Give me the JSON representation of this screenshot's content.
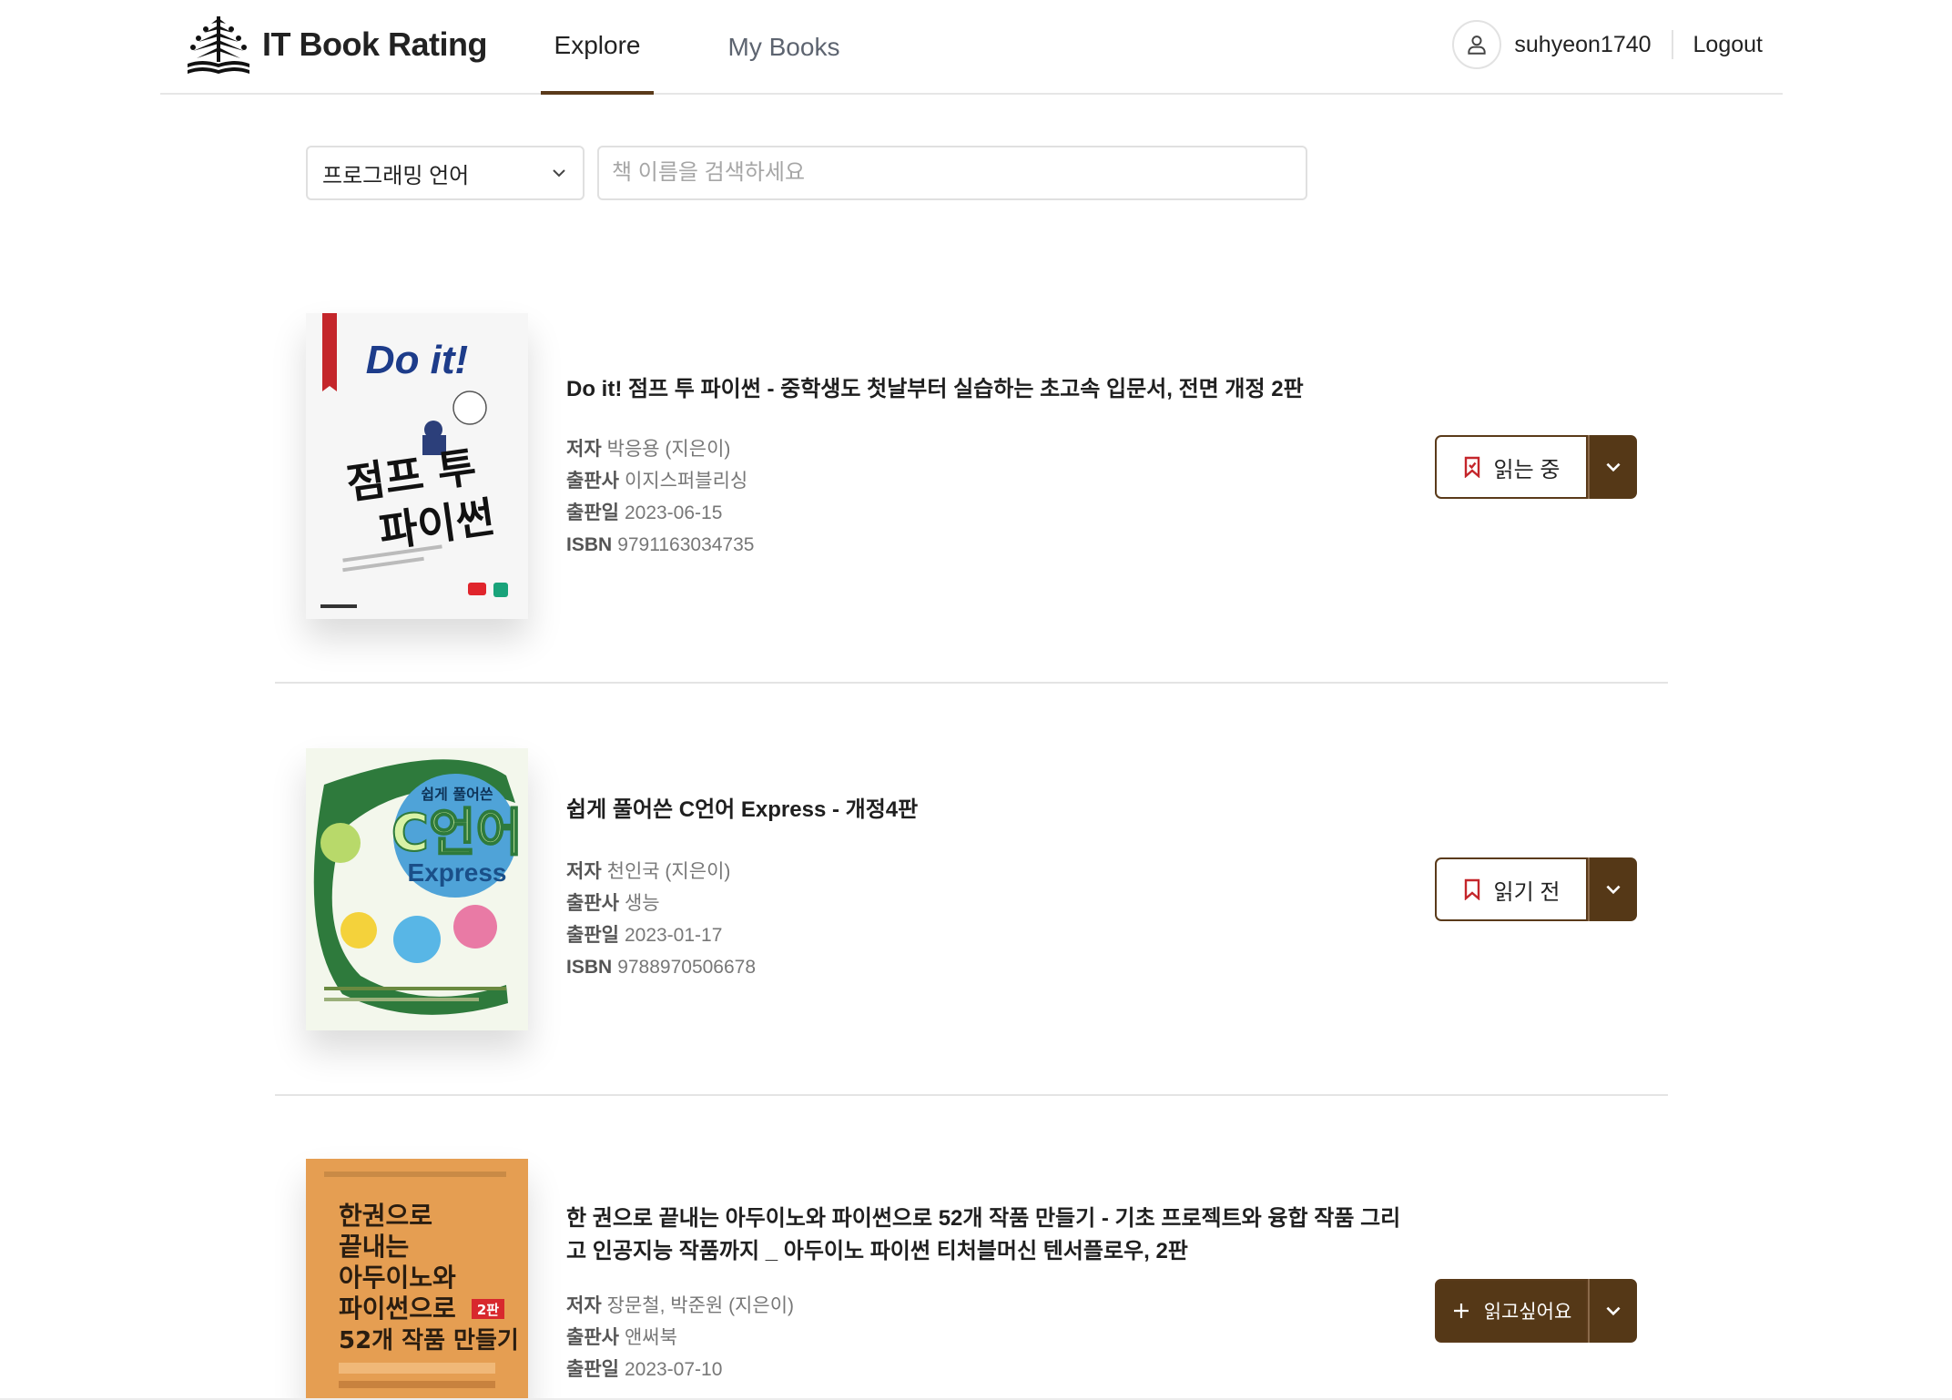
{
  "header": {
    "logo_text": "IT Book Rating",
    "tabs": [
      {
        "label": "Explore",
        "active": true
      },
      {
        "label": "My Books",
        "active": false
      }
    ],
    "username": "suhyeon1740",
    "logout_label": "Logout"
  },
  "search": {
    "category_value": "프로그래밍 언어",
    "placeholder": "책 이름을 검색하세요"
  },
  "meta_labels": {
    "author": "저자",
    "publisher": "출판사",
    "date": "출판일",
    "isbn": "ISBN"
  },
  "books": [
    {
      "title": "Do it! 점프 투 파이썬 - 중학생도 첫날부터 실습하는 초고속 입문서, 전면 개정 2판",
      "author": "박응용 (지은이)",
      "publisher": "이지스퍼블리싱",
      "date": "2023-06-15",
      "isbn": "9791163034735",
      "status_label": "읽는 중",
      "status_icon": "bookmark-icon",
      "cover": {
        "top_text": "Do it!",
        "main_line1": "점프 투",
        "main_line2": "파이썬"
      }
    },
    {
      "title": "쉽게 풀어쓴 C언어 Express - 개정4판",
      "author": "천인국 (지은이)",
      "publisher": "생능",
      "date": "2023-01-17",
      "isbn": "9788970506678",
      "status_label": "읽기 전",
      "status_icon": "bookmark-icon",
      "cover": {
        "badge": "쉽게 풀어쓴",
        "main": "C언어",
        "sub": "Express"
      }
    },
    {
      "title": "한 권으로 끝내는 아두이노와 파이썬으로 52개 작품 만들기 - 기초 프로젝트와 융합 작품 그리고 인공지능 작품까지 _ 아두이노 파이썬 티처블머신 텐서플로우, 2판",
      "author": "장문철, 박준원 (지은이)",
      "publisher": "앤써북",
      "date": "2023-07-10",
      "status_label": "읽고싶어요",
      "status_icon": "plus-icon",
      "cover": {
        "lines": [
          "한권으로",
          "끝내는",
          "아두이노와",
          "파이썬으로",
          "52개 작품 만들기"
        ],
        "edition": "2판"
      }
    }
  ],
  "colors": {
    "accent": "#553817",
    "border": "#e0e0e0"
  }
}
